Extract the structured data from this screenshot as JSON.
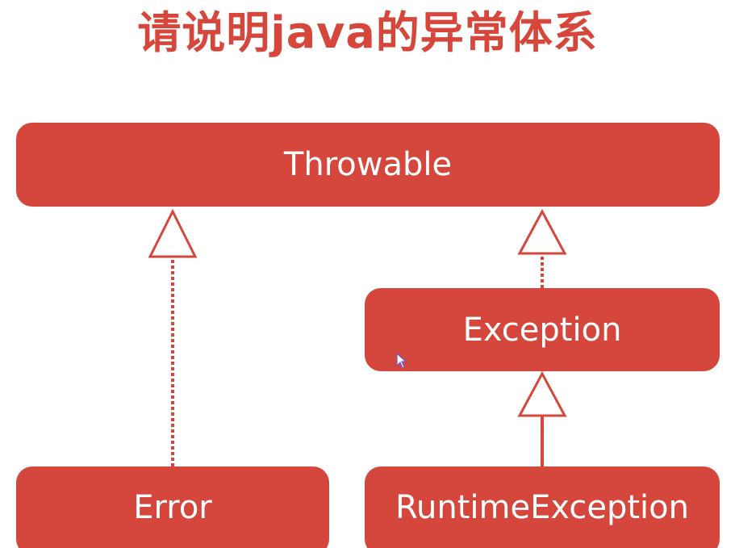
{
  "title": "请说明java的异常体系",
  "nodes": {
    "throwable": "Throwable",
    "exception": "Exception",
    "error": "Error",
    "runtime_exception": "RuntimeException"
  },
  "colors": {
    "accent": "#d5463c",
    "title": "#d6463b",
    "box_text": "#ffffff"
  }
}
